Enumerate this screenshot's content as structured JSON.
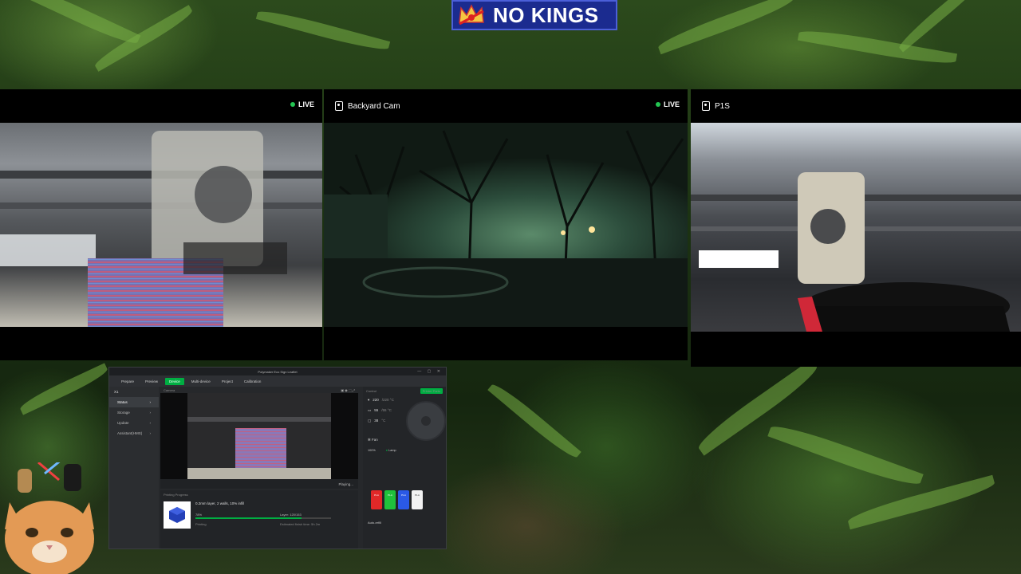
{
  "logo": {
    "text": "NO KINGS",
    "colors": {
      "bg": "#1b2b8f",
      "crown": "#f5c542"
    }
  },
  "cameras": [
    {
      "title": "",
      "live_label": "LIVE",
      "live": true
    },
    {
      "title": "Backyard Cam",
      "live_label": "LIVE",
      "live": true
    },
    {
      "title": "P1S",
      "live_label": "",
      "live": false
    }
  ],
  "studio": {
    "window_title": "Polymaker Eco Sign Leaflet",
    "window_controls": "— ▢ ✕",
    "nav_tabs": [
      {
        "label": "Prepare",
        "active": false
      },
      {
        "label": "Preview",
        "active": false
      },
      {
        "label": "Device",
        "active": true
      },
      {
        "label": "Multi-device",
        "active": false
      },
      {
        "label": "Project",
        "active": false
      },
      {
        "label": "Calibration",
        "active": false
      }
    ],
    "device_name": "X1",
    "sidebar": [
      {
        "label": "Status",
        "active": true
      },
      {
        "label": "Storage",
        "active": false
      },
      {
        "label": "Update",
        "active": false
      },
      {
        "label": "Assistant(HMS)",
        "active": false
      }
    ],
    "camera_header": "Camera",
    "camera_status": "Playing...",
    "progress": {
      "header": "Printing Progress",
      "description": "0.2mm layer, 2 walls, 10% infill",
      "percent_label": "78%",
      "percent": 78,
      "layer_label": "Layer: 120/153",
      "state": "Printing",
      "eta": "Estimated finish time: 5h 2m"
    },
    "control": {
      "header": "Control",
      "parts_button": "Printer Parts",
      "temps": [
        {
          "value": "220",
          "target": "/220 °C"
        },
        {
          "value": "55",
          "target": "/55 °C"
        },
        {
          "value": "38",
          "target": "°C"
        }
      ],
      "fan_label": "Fan",
      "speed_label": "100%",
      "lamp_label": "Lamp",
      "spools": [
        {
          "label": "PLA",
          "color": "#e02828"
        },
        {
          "label": "PLA",
          "color": "#1fc23b"
        },
        {
          "label": "PLA",
          "color": "#2a59e6"
        },
        {
          "label": "PLA",
          "color": "#f2f2f2"
        }
      ],
      "auto_refill": "Auto-refill"
    }
  }
}
